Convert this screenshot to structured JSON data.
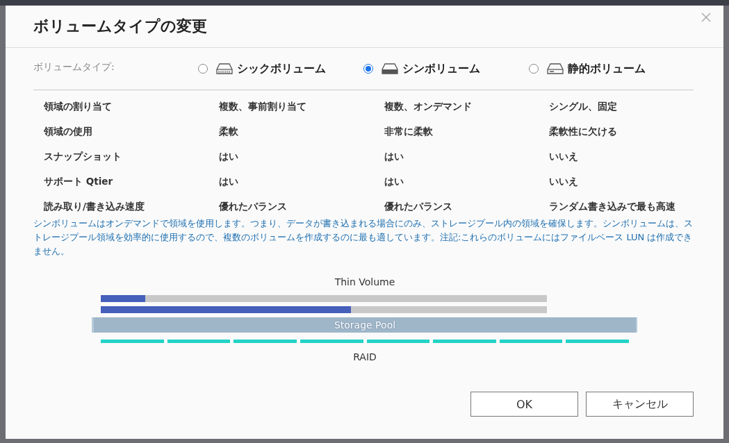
{
  "dialog": {
    "title": "ボリュームタイプの変更"
  },
  "volume_type": {
    "label": "ボリュームタイプ:",
    "options": [
      {
        "label": "シックボリューム",
        "kind": "thick",
        "selected": false
      },
      {
        "label": "シンボリューム",
        "kind": "thin",
        "selected": true
      },
      {
        "label": "静的ボリューム",
        "kind": "static",
        "selected": false
      }
    ]
  },
  "comparison_rows": [
    [
      "領域の割り当て",
      "複数、事前割り当て",
      "複数、オンデマンド",
      "シングル、固定"
    ],
    [
      "領域の使用",
      "柔軟",
      "非常に柔軟",
      "柔軟性に欠ける"
    ],
    [
      "スナップショット",
      "はい",
      "はい",
      "いいえ"
    ],
    [
      "サポート Qtier",
      "はい",
      "はい",
      "いいえ"
    ],
    [
      "読み取り/書き込み速度",
      "優れたバランス",
      "優れたバランス",
      "ランダム書き込みで最も高速"
    ]
  ],
  "description": "シンボリュームはオンデマンドで領域を使用します。つまり、データが書き込まれる場合にのみ、ストレージプール内の領域を確保します。シンボリュームは、ストレージプール領域を効率的に使用するので、複数のボリュームを作成するのに最も適しています。注記:これらのボリュームにはファイルベース LUN は作成できません。",
  "diagram": {
    "title": "Thin Volume",
    "volumes": [
      {
        "level": 0.1
      },
      {
        "level": 0.56
      }
    ],
    "pool_label": "Storage Pool",
    "raid_label": "RAID"
  },
  "buttons": [
    "OK",
    "キャンセル"
  ]
}
